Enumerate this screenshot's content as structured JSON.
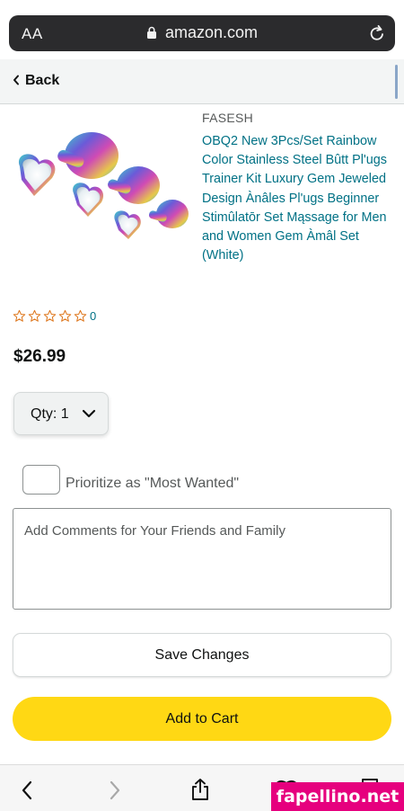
{
  "browser": {
    "text_size_label": "AA",
    "url": "amazon.com"
  },
  "header": {
    "back_label": "Back"
  },
  "product": {
    "brand": "FASESH",
    "title": "OBQ2 New 3Pcs/Set Rainbow Color Stainless Steel Bûtt Pl'ugs Trainer Kit Luxury Gem Jeweled Design Ànâles Pl'ugs Beginner Stimûlatōr Set Mąssage for Men and Women Gem Àmâl Set (White)",
    "rating_stars": 0,
    "rating_count": "0",
    "price": "$26.99"
  },
  "quantity": {
    "label": "Qty:",
    "value": "1"
  },
  "priority": {
    "label": "Prioritize as \"Most Wanted\"",
    "checked": false
  },
  "comments": {
    "placeholder": "Add Comments for Your Friends and Family",
    "value": ""
  },
  "actions": {
    "save_label": "Save Changes",
    "add_to_cart_label": "Add to Cart"
  },
  "watermark": "fapellino.net",
  "colors": {
    "link": "#007185",
    "add_to_cart": "#FFD814",
    "star_outline": "#DE7921"
  }
}
